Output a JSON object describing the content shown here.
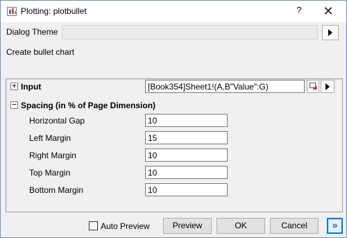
{
  "window": {
    "title": "Plotting: plotbullet",
    "help_glyph": "?",
    "close_glyph": "✕"
  },
  "theme": {
    "label": "Dialog Theme",
    "value": ""
  },
  "description": "Create bullet chart",
  "tree": {
    "input": {
      "expander": "+",
      "label": "Input",
      "value": "[Book354]Sheet1!(A,B\"Value\":G)"
    },
    "spacing": {
      "expander": "−",
      "label": "Spacing (in % of Page Dimension)",
      "fields": [
        {
          "label": "Horizontal Gap",
          "value": "10"
        },
        {
          "label": "Left Margin",
          "value": "15"
        },
        {
          "label": "Right Margin",
          "value": "10"
        },
        {
          "label": "Top Margin",
          "value": "10"
        },
        {
          "label": "Bottom Margin",
          "value": "10"
        }
      ]
    }
  },
  "footer": {
    "auto_preview_label": "Auto Preview",
    "auto_preview_checked": false,
    "preview_label": "Preview",
    "ok_label": "OK",
    "cancel_label": "Cancel",
    "more_glyph": "»"
  },
  "colors": {
    "accent": "#0078d7",
    "titlebar": "#ffffff",
    "dialog_bg": "#f0f0f0"
  }
}
